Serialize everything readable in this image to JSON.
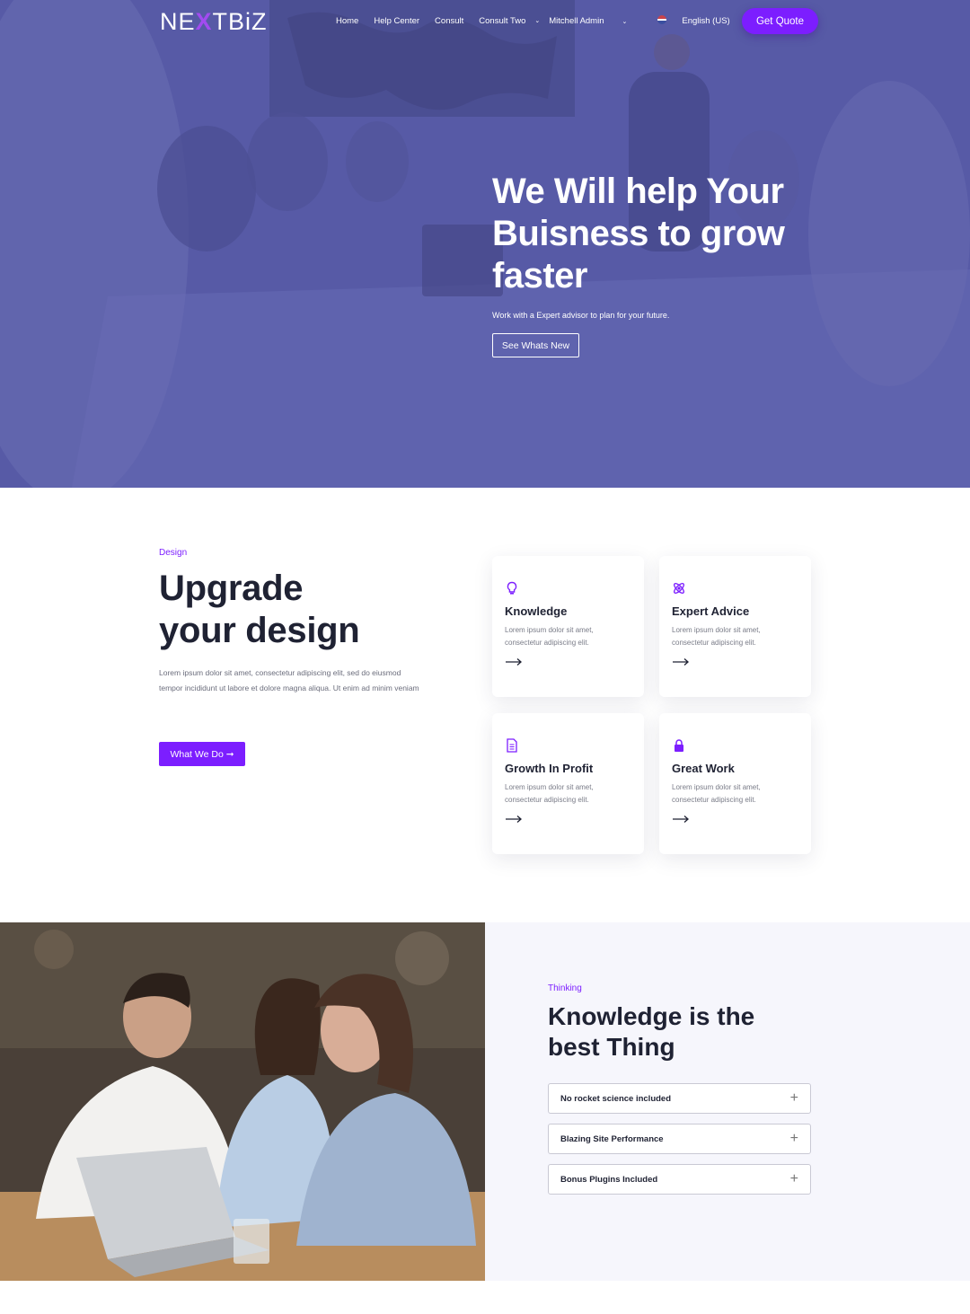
{
  "nav": {
    "logo": {
      "part1": "NE",
      "part2": "X",
      "part3": "TBiZ"
    },
    "links": [
      "Home",
      "Help Center",
      "Consult",
      "Consult Two"
    ],
    "user": "Mitchell Admin",
    "language": "English (US)",
    "cta": "Get Quote"
  },
  "hero": {
    "title": "We Will help Your Buisness to grow faster",
    "subtitle": "Work with a Expert advisor to plan for your future.",
    "button": "See Whats New"
  },
  "design": {
    "eyebrow": "Design",
    "title_line1": "Upgrade",
    "title_line2": "your design",
    "text": "Lorem ipsum dolor sit amet, consectetur adipiscing elit, sed do eiusmod tempor incididunt ut labore et dolore magna aliqua. Ut enim ad minim veniam",
    "button": "What We Do ➞",
    "cards": [
      {
        "icon": "lightbulb-icon",
        "title": "Knowledge",
        "text": "Lorem ipsum dolor sit amet, consectetur adipiscing elit."
      },
      {
        "icon": "atom-icon",
        "title": "Expert Advice",
        "text": "Lorem ipsum dolor sit amet, consectetur adipiscing elit."
      },
      {
        "icon": "document-icon",
        "title": "Growth In Profit",
        "text": "Lorem ipsum dolor sit amet, consectetur adipiscing elit."
      },
      {
        "icon": "lock-icon",
        "title": "Great Work",
        "text": "Lorem ipsum dolor sit amet, consectetur adipiscing elit."
      }
    ]
  },
  "thinking": {
    "eyebrow": "Thinking",
    "title_line1": "Knowledge is the",
    "title_line2": "best Thing",
    "accordion": [
      "No rocket science included",
      "Blazing Site Performance",
      "Bonus Plugins Included"
    ]
  },
  "colors": {
    "accent": "#7c1eff",
    "hero_overlay": "#5a5ea6",
    "panel_bg": "#f6f6fc",
    "heading": "#1f2233"
  }
}
